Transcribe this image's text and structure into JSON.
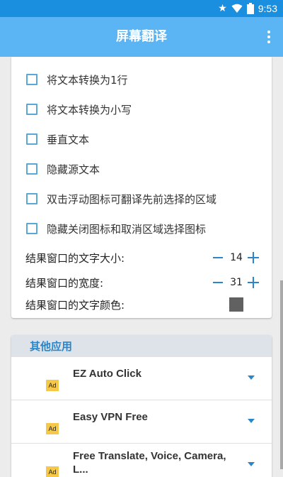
{
  "status_bar": {
    "time": "9:53"
  },
  "app_bar": {
    "title": "屏幕翻译"
  },
  "options": [
    {
      "label": "将文本转换为1行",
      "checked": false
    },
    {
      "label": "将文本转换为小写",
      "checked": false
    },
    {
      "label": "垂直文本",
      "checked": false
    },
    {
      "label": "隐藏源文本",
      "checked": false
    },
    {
      "label": "双击浮动图标可翻译先前选择的区域",
      "checked": false
    },
    {
      "label": "隐藏关闭图标和取消区域选择图标",
      "checked": false
    }
  ],
  "settings": {
    "font_size": {
      "label": "结果窗口的文字大小:",
      "value": "14"
    },
    "width": {
      "label": "结果窗口的宽度:",
      "value": "31"
    },
    "text_color": {
      "label": "结果窗口的文字颜色:",
      "color": "#616161"
    }
  },
  "other_apps": {
    "title": "其他应用",
    "items": [
      {
        "name": "EZ Auto Click",
        "badge": "Ad"
      },
      {
        "name": "Easy VPN Free",
        "badge": "Ad"
      },
      {
        "name": "Free Translate, Voice, Camera, L...",
        "badge": "Ad"
      }
    ]
  },
  "colors": {
    "status_bar": "#1a8fe0",
    "app_bar": "#5bb5f5",
    "accent": "#2a86c9",
    "checkbox_border": "#5ba8d6",
    "ad_badge": "#f6c84a"
  }
}
